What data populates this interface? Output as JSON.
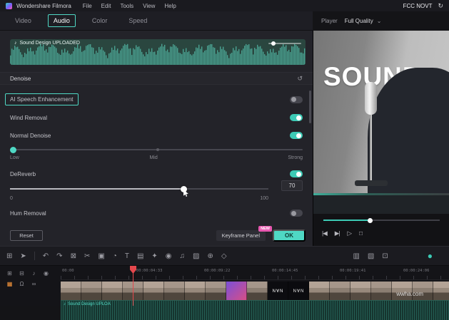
{
  "menu": {
    "app_name": "Wondershare Filmora",
    "items": [
      "File",
      "Edit",
      "Tools",
      "View",
      "Help"
    ],
    "right_text": "FCC NOVT"
  },
  "tabs": {
    "items": [
      "Video",
      "Audio",
      "Color",
      "Speed"
    ],
    "active": "Audio"
  },
  "player": {
    "label": "Player",
    "quality": "Full Quality"
  },
  "audio_panel": {
    "clip_name": "Sound Design UPLOADED",
    "denoise_title": "Denoise",
    "ai_speech_label": "AI Speech Enhancement",
    "wind_label": "Wind Removal",
    "normal_label": "Normal Denoise",
    "level_low": "Low",
    "level_mid": "Mid",
    "level_strong": "Strong",
    "dereverb_label": "DeReverb",
    "dereverb_value": "70",
    "scale_min": "0",
    "scale_max": "100",
    "hum_label": "Hum Removal",
    "reset_label": "Reset",
    "keyframe_label": "Keyframe Panel",
    "new_badge": "NEW",
    "ok_label": "OK",
    "toggles": {
      "ai_speech": false,
      "wind": true,
      "normal": true,
      "dereverb": true,
      "hum": false
    }
  },
  "preview": {
    "overlay_text": "SOUND"
  },
  "timeline": {
    "ruler": [
      "00:00",
      "00:00:04:33",
      "00:00:09:22",
      "00:00:14:45",
      "00:00:19:41",
      "00:00:24:06"
    ],
    "audio_clip_label": "Sound Design UPLOA",
    "title_clip_text": "N∀N",
    "watermark": "wwha.com"
  },
  "icons": {
    "sync": "↻",
    "chevron": "⌄",
    "note": "♪",
    "reset_section": "↺",
    "media": "⊞",
    "pointer": "➤",
    "undo": "↶",
    "redo": "↷",
    "delete": "⊠",
    "split": "✂",
    "crop": "▣",
    "speed": "◔",
    "text": "T",
    "transition": "▤",
    "effects": "✦",
    "record": "◉",
    "mixer": "♫",
    "chroma": "▨",
    "zoom": "⊕",
    "marker": "◇",
    "pip": "▥",
    "mask": "▧",
    "frame": "⊡",
    "render": "●",
    "add_track": "⊞",
    "track_menu": "⊟",
    "mute": "♪",
    "eye": "◉",
    "kf_colors": "▦",
    "magnet": "Ω",
    "link": "∞",
    "prev": "|◀",
    "next": "▶|",
    "play": "▷",
    "stop": "□"
  }
}
